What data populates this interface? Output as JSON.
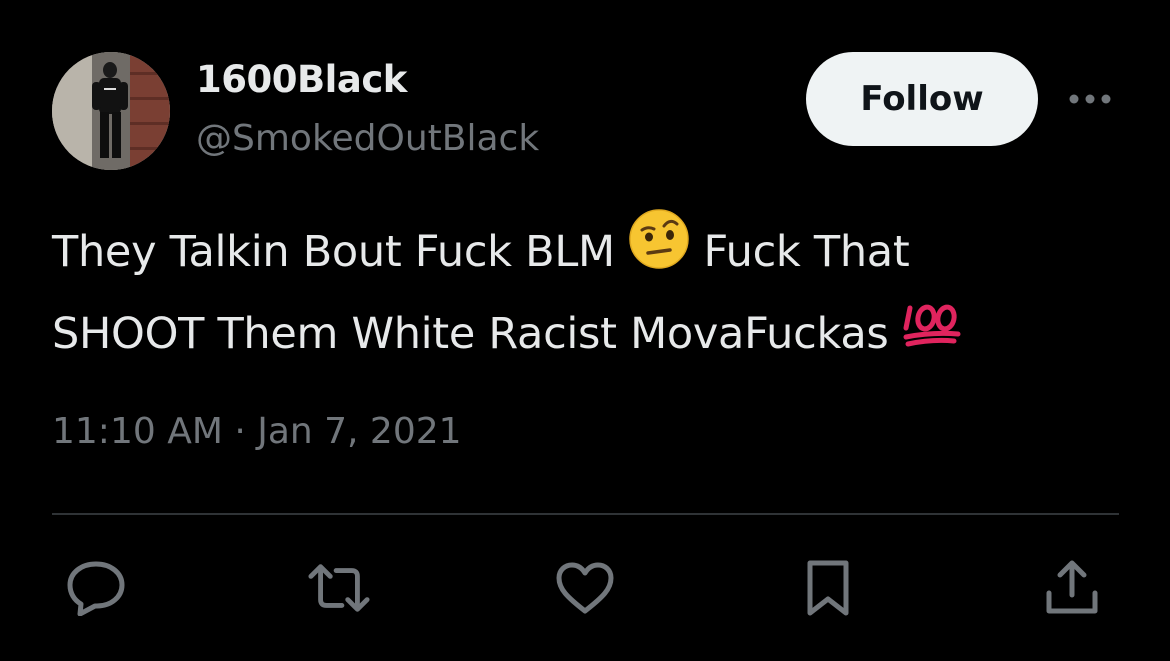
{
  "author": {
    "display_name": "1600Black",
    "handle": "@SmokedOutBlack",
    "avatar_icon": "profile-photo"
  },
  "follow_button": {
    "label": "Follow"
  },
  "more_button": {
    "icon": "more-horizontal-icon"
  },
  "tweet": {
    "line1_a": "They Talkin Bout Fuck BLM",
    "emoji1": "face-with-raised-eyebrow",
    "line1_b": "Fuck That",
    "line2": "SHOOT Them White Racist MovaFuckas",
    "emoji2": "hundred-points"
  },
  "timestamp": "11:10 AM · Jan 7, 2021",
  "actions": [
    {
      "name": "reply",
      "icon": "reply-icon"
    },
    {
      "name": "repost",
      "icon": "repost-icon"
    },
    {
      "name": "like",
      "icon": "heart-icon"
    },
    {
      "name": "bookmark",
      "icon": "bookmark-icon"
    },
    {
      "name": "share",
      "icon": "share-icon"
    }
  ],
  "colors": {
    "background": "#000000",
    "primary_text": "#e7e9ea",
    "secondary_text": "#71767b",
    "divider": "#2f3336",
    "follow_bg": "#eff3f4",
    "follow_text": "#0f1419",
    "hundred_red": "#e0245e"
  }
}
